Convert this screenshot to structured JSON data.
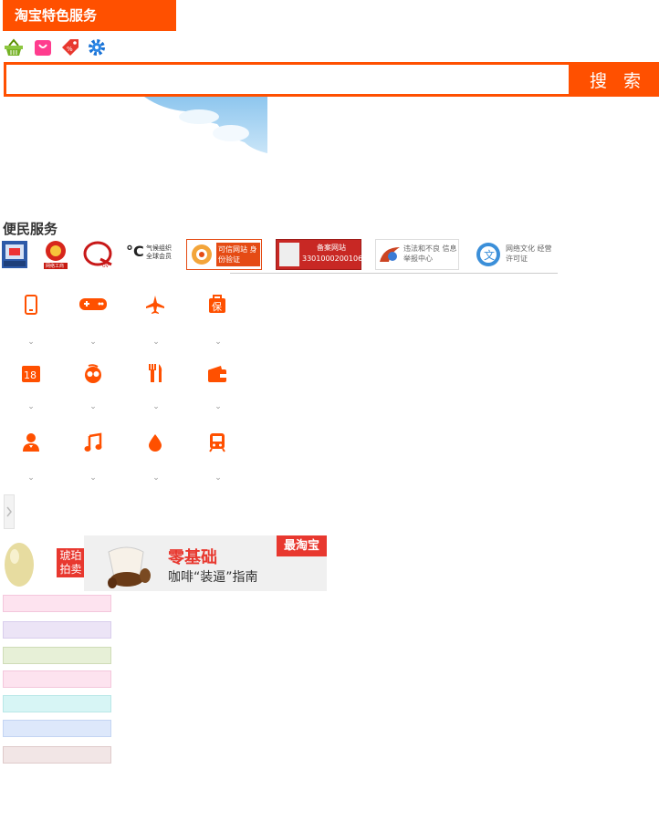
{
  "header": {
    "title": "淘宝特色服务"
  },
  "toolbar": {
    "icons": [
      "basket-icon",
      "shopping-bag-icon",
      "discount-tag-icon",
      "gear-icon"
    ]
  },
  "search": {
    "value": "",
    "placeholder": "",
    "button_label": "搜 索"
  },
  "services": {
    "title": "便民服务",
    "badges": [
      {
        "name": "police-badge",
        "text": ""
      },
      {
        "name": "business-registration-badge",
        "text": "网络工商"
      },
      {
        "name": "cnnic-badge",
        "text": ""
      },
      {
        "name": "climate-badge",
        "text": "气候组织 全球会员"
      },
      {
        "name": "trusted-site-badge",
        "text": "可信网站 身份验证"
      },
      {
        "name": "record-site-badge",
        "text": "备案网站 33010002001060"
      },
      {
        "name": "report-center-badge",
        "text": "违法和不良 信息举报中心"
      },
      {
        "name": "culture-license-badge",
        "text": "网络文化 经营许可证"
      }
    ]
  },
  "service_grid": [
    [
      "phone-icon",
      "gamepad-icon",
      "airplane-icon",
      "insurance-icon"
    ],
    [
      "lottery-icon",
      "glasses-face-icon",
      "dining-icon",
      "wallet-icon"
    ],
    [
      "person-icon",
      "music-note-icon",
      "water-drop-icon",
      "train-icon"
    ]
  ],
  "ad_banner": {
    "tag": "琥珀 拍卖",
    "logo": "最淘宝",
    "headline": "零基础",
    "subline": "咖啡“装逼”指南"
  },
  "colors": {
    "accent": "#ff5000",
    "strips": [
      "#fde3ef",
      "#ece4f6",
      "#e7f0d7",
      "#fde3ef",
      "#d7f5f5",
      "#dde8fb",
      "#f2e6e6"
    ]
  }
}
